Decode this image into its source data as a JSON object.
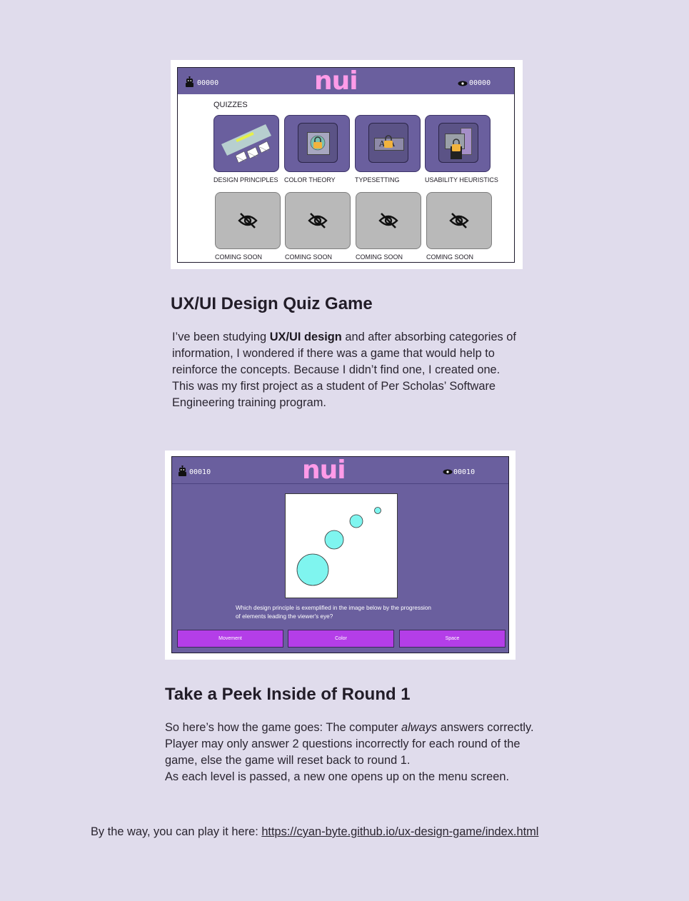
{
  "screenshot1": {
    "logo": "nui",
    "left_score": "00000",
    "right_score": "00000",
    "quizzes_heading": "QUIZZES",
    "quizzes": [
      {
        "label": "DESIGN PRINCIPLES",
        "icon": "design-principles-art",
        "locked": false
      },
      {
        "label": "COLOR THEORY",
        "icon": "color-theory-art",
        "locked": true
      },
      {
        "label": "TYPESETTING",
        "icon": "typesetting-art",
        "locked": true
      },
      {
        "label": "USABILITY HEURISTICS",
        "icon": "usability-heuristics-art",
        "locked": true
      }
    ],
    "coming_soon": [
      {
        "label": "COMING SOON",
        "icon": "eye-slash-icon"
      },
      {
        "label": "COMING SOON",
        "icon": "eye-slash-icon"
      },
      {
        "label": "COMING SOON",
        "icon": "eye-slash-icon"
      },
      {
        "label": "COMING SOON",
        "icon": "eye-slash-icon"
      }
    ]
  },
  "section1": {
    "title": "UX/UI Design Quiz Game",
    "p_lead": "I’ve been studying ",
    "p_bold": "UX/UI design",
    "p_rest": " and after absorbing categories of information, I wondered if there was a game that would help to reinforce the concepts. Because I didn’t find one, I created one. This was my first project as a student of Per Scholas’ Software Engineering training program."
  },
  "screenshot2": {
    "logo": "nui",
    "left_score": "00010",
    "right_score": "00010",
    "question": "Which design principle is exemplified in the image below by the progression of elements leading the viewer's eye?",
    "answers": [
      "Movement",
      "Color",
      "Space"
    ]
  },
  "section2": {
    "title": "Take a Peek Inside of Round 1",
    "p_lead": "So here’s how the game goes: The computer ",
    "p_italic": "always",
    "p_rest": " answers correctly. Player may only answer 2 questions incorrectly for each round of the game, else the game will reset back to round 1.",
    "p_line2": "As each level is passed, a new one opens up on the menu screen."
  },
  "closing": {
    "text": "By the way, you can play it here: ",
    "link": "https://cyan-byte.github.io/ux-design-game/index.html"
  },
  "colors": {
    "page_bg": "#e0dcec",
    "game_purple": "#6a5f9e",
    "logo_pink": "#ff9be8",
    "answer_button": "#b43ee8",
    "circle_cyan": "#7ff5ef"
  }
}
